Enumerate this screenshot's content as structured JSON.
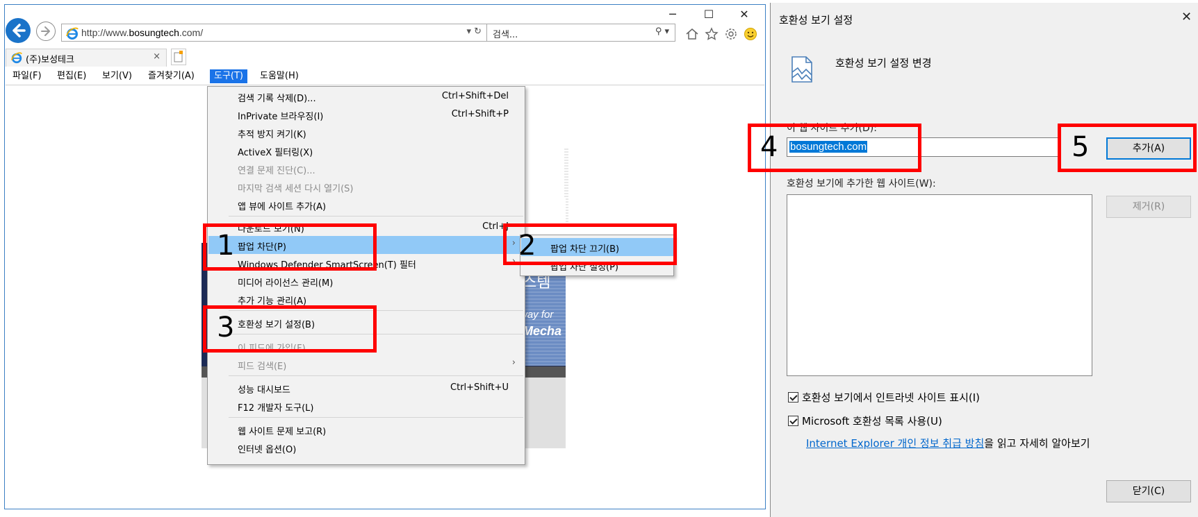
{
  "browser": {
    "window_controls": [
      "─",
      "☐",
      "✕"
    ],
    "address_url_prefix": "http://www.",
    "address_url_domain": "bosungtech",
    "address_url_suffix": ".com/",
    "address_controls": "▾ ↻",
    "search_placeholder": "검색...",
    "search_controls": "⚲ ▾",
    "tab_title": "(주)보성테크",
    "tab_close": "×",
    "menubar": [
      "파일(F)",
      "편집(E)",
      "보기(V)",
      "즐겨찾기(A)",
      "도구(T)",
      "도움말(H)"
    ],
    "active_menu": "도구(T)",
    "page_text": [
      "스템",
      "way for",
      "Mecha"
    ]
  },
  "tools_menu": {
    "items": [
      {
        "label": "검색 기록 삭제(D)...",
        "shortcut": "Ctrl+Shift+Del"
      },
      {
        "label": "InPrivate 브라우징(I)",
        "shortcut": "Ctrl+Shift+P"
      },
      {
        "label": "추적 방지 켜기(K)",
        "shortcut": ""
      },
      {
        "label": "ActiveX 필터링(X)",
        "shortcut": ""
      },
      {
        "label": "연결 문제 진단(C)...",
        "shortcut": ""
      },
      {
        "label": "마지막 검색 세션 다시 열기(S)",
        "shortcut": ""
      },
      {
        "label": "앱 뷰에 사이트 추가(A)",
        "shortcut": ""
      },
      {
        "label": "다운로드 보기(N)",
        "shortcut": "Ctrl+J"
      },
      {
        "label": "팝업 차단(P)",
        "shortcut": ""
      },
      {
        "label": "Windows Defender SmartScreen(T) 필터",
        "shortcut": ""
      },
      {
        "label": "미디어 라이선스 관리(M)",
        "shortcut": ""
      },
      {
        "label": "추가 기능 관리(A)",
        "shortcut": ""
      },
      {
        "label": "호환성 보기 설정(B)",
        "shortcut": ""
      },
      {
        "label": "이 피드에 가입(F)...",
        "shortcut": ""
      },
      {
        "label": "피드 검색(E)",
        "shortcut": ""
      },
      {
        "label": "성능 대시보드",
        "shortcut": "Ctrl+Shift+U"
      },
      {
        "label": "F12 개발자 도구(L)",
        "shortcut": ""
      },
      {
        "label": "웹 사이트 문제 보고(R)",
        "shortcut": ""
      },
      {
        "label": "인터넷 옵션(O)",
        "shortcut": ""
      }
    ],
    "submenu_arrow": "›",
    "popup_submenu": [
      "팝업 차단 끄기(B)",
      "팝업 차단 설정(P)"
    ]
  },
  "dialog": {
    "title": "호환성 보기 설정",
    "close": "✕",
    "heading": "호환성 보기 설정 변경",
    "add_site_label": "이 웹 사이트 추가(D):",
    "add_site_value": "bosungtech.com",
    "add_button": "추가(A)",
    "list_label": "호환성 보기에 추가한 웹 사이트(W):",
    "remove_button": "제거(R)",
    "checkbox_intranet": "호환성 보기에서 인트라넷 사이트 표시(I)",
    "checkbox_mslist": "Microsoft 호환성 목록 사용(U)",
    "privacy_link": "Internet Explorer 개인 정보 취급 방침",
    "privacy_suffix": "을 읽고 자세히 알아보기",
    "close_button": "닫기(C)"
  },
  "annotations": [
    "1",
    "2",
    "3",
    "4",
    "5"
  ],
  "colors": {
    "accent_blue": "#1a73e8",
    "highlight": "#91c9f7",
    "annotation_red": "#ff0000",
    "selection_blue": "#0078d7"
  },
  "icons": {
    "back": "back-arrow-icon",
    "forward": "forward-arrow-icon",
    "ie": "ie-logo-icon",
    "home": "home-icon",
    "favorites": "star-icon",
    "settings": "gear-icon",
    "feedback": "smiley-icon",
    "compat": "broken-page-icon"
  }
}
